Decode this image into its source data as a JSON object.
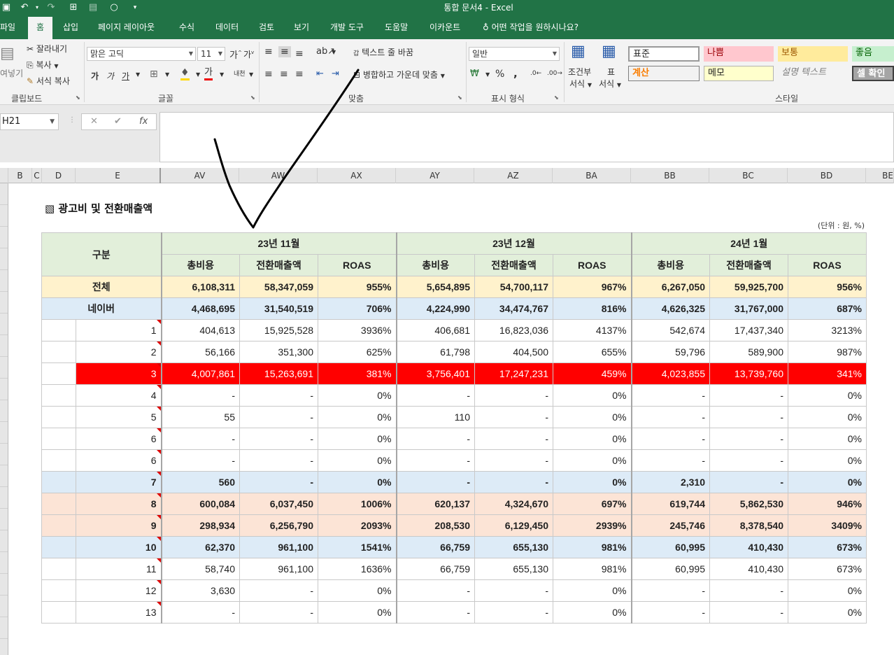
{
  "titlebar": {
    "title": "통합 문서4  -  Excel"
  },
  "tabs": [
    {
      "label": "파일"
    },
    {
      "label": "홈"
    },
    {
      "label": "삽입"
    },
    {
      "label": "페이지 레이아웃"
    },
    {
      "label": "수식"
    },
    {
      "label": "데이터"
    },
    {
      "label": "검토"
    },
    {
      "label": "보기"
    },
    {
      "label": "개발 도구"
    },
    {
      "label": "도움말"
    },
    {
      "label": "이카운트"
    },
    {
      "label": "어떤 작업을 원하시나요?"
    }
  ],
  "ribbon": {
    "clipboard": {
      "paste": "여넣기",
      "cut": "잘라내기",
      "copy": "복사",
      "format_painter": "서식 복사",
      "label": "클립보드"
    },
    "font": {
      "font_name": "맑은 고딕",
      "font_size": "11",
      "bold": "가",
      "italic": "가",
      "underline": "가",
      "color_a": "가",
      "label": "글꼴"
    },
    "align": {
      "wrap": "텍스트 줄 바꿈",
      "merge": "병합하고 가운데 맞춤",
      "label": "맞춤",
      "wrap_icon": "갑",
      "orient": "내천"
    },
    "number": {
      "format": "일반",
      "percent": "%",
      "comma": ",",
      "label": "표시 형식"
    },
    "styles": {
      "cond_format": "조건부 서식",
      "cond_format_1": "조건부",
      "cond_format_2": "서식",
      "table_format_1": "표",
      "table_format_2": "서식",
      "label": "스타일",
      "cells": [
        {
          "text": "표준"
        },
        {
          "text": "나쁨"
        },
        {
          "text": "보통"
        },
        {
          "text": "좋음"
        },
        {
          "text": "계산"
        },
        {
          "text": "메모"
        },
        {
          "text": "설명 텍스트"
        },
        {
          "text": "셀 확인"
        }
      ]
    }
  },
  "formula_bar": {
    "name_box": "H21",
    "fx": "fx",
    "cancel": "✕",
    "enter": "✔",
    "value": ""
  },
  "columns": [
    "B",
    "C",
    "D",
    "E",
    "AV",
    "AW",
    "AX",
    "AY",
    "AZ",
    "BA",
    "BB",
    "BC",
    "BD",
    "BE"
  ],
  "sheet": {
    "title": "광고비 및 전환매출액",
    "unit": "(단위 : 원, %)",
    "header_category": "구분",
    "months": [
      "23년 11월",
      "23년 12월",
      "24년 1월"
    ],
    "sub_headers": [
      "총비용",
      "전환매출액",
      "ROAS"
    ],
    "rows": [
      {
        "label": "전체",
        "style": "total",
        "cells": [
          "6,108,311",
          "58,347,059",
          "955%",
          "5,654,895",
          "54,700,117",
          "967%",
          "6,267,050",
          "59,925,700",
          "956%"
        ]
      },
      {
        "label": "네이버",
        "style": "blue",
        "cells": [
          "4,468,695",
          "31,540,519",
          "706%",
          "4,224,990",
          "34,474,767",
          "816%",
          "4,626,325",
          "31,767,000",
          "687%"
        ]
      },
      {
        "label": "1",
        "style": "sub",
        "cells": [
          "404,613",
          "15,925,528",
          "3936%",
          "406,681",
          "16,823,036",
          "4137%",
          "542,674",
          "17,437,340",
          "3213%"
        ]
      },
      {
        "label": "2",
        "style": "sub",
        "cells": [
          "56,166",
          "351,300",
          "625%",
          "61,798",
          "404,500",
          "655%",
          "59,796",
          "589,900",
          "987%"
        ]
      },
      {
        "label": "3",
        "style": "red",
        "cells": [
          "4,007,861",
          "15,263,691",
          "381%",
          "3,756,401",
          "17,247,231",
          "459%",
          "4,023,855",
          "13,739,760",
          "341%"
        ]
      },
      {
        "label": "4",
        "style": "sub",
        "cells": [
          "-",
          "-",
          "0%",
          "-",
          "-",
          "0%",
          "-",
          "-",
          "0%"
        ]
      },
      {
        "label": "5",
        "style": "sub",
        "cells": [
          "55",
          "-",
          "0%",
          "110",
          "-",
          "0%",
          "-",
          "-",
          "0%"
        ]
      },
      {
        "label": "6",
        "style": "sub",
        "cells": [
          "-",
          "-",
          "0%",
          "-",
          "-",
          "0%",
          "-",
          "-",
          "0%"
        ]
      },
      {
        "label": "6",
        "style": "sub",
        "cells": [
          "-",
          "-",
          "0%",
          "-",
          "-",
          "0%",
          "-",
          "-",
          "0%"
        ]
      },
      {
        "label": "7",
        "style": "blue",
        "cells": [
          "560",
          "-",
          "0%",
          "-",
          "-",
          "0%",
          "2,310",
          "-",
          "0%"
        ]
      },
      {
        "label": "8",
        "style": "peach",
        "cells": [
          "600,084",
          "6,037,450",
          "1006%",
          "620,137",
          "4,324,670",
          "697%",
          "619,744",
          "5,862,530",
          "946%"
        ]
      },
      {
        "label": "9",
        "style": "peach",
        "cells": [
          "298,934",
          "6,256,790",
          "2093%",
          "208,530",
          "6,129,450",
          "2939%",
          "245,746",
          "8,378,540",
          "3409%"
        ]
      },
      {
        "label": "10",
        "style": "blue",
        "cells": [
          "62,370",
          "961,100",
          "1541%",
          "66,759",
          "655,130",
          "981%",
          "60,995",
          "410,430",
          "673%"
        ]
      },
      {
        "label": "11",
        "style": "sub",
        "cells": [
          "58,740",
          "961,100",
          "1636%",
          "66,759",
          "655,130",
          "981%",
          "60,995",
          "410,430",
          "673%"
        ]
      },
      {
        "label": "12",
        "style": "sub",
        "cells": [
          "3,630",
          "-",
          "0%",
          "-",
          "-",
          "0%",
          "-",
          "-",
          "0%"
        ]
      },
      {
        "label": "13",
        "style": "sub",
        "cells": [
          "-",
          "-",
          "0%",
          "-",
          "-",
          "0%",
          "-",
          "-",
          "0%"
        ]
      }
    ]
  },
  "colors": {
    "excel_green": "#217346",
    "highlight_red": "#ff0000",
    "total_yellow": "#fff2cc",
    "blue_row": "#ddebf7",
    "peach_row": "#fce4d6"
  }
}
